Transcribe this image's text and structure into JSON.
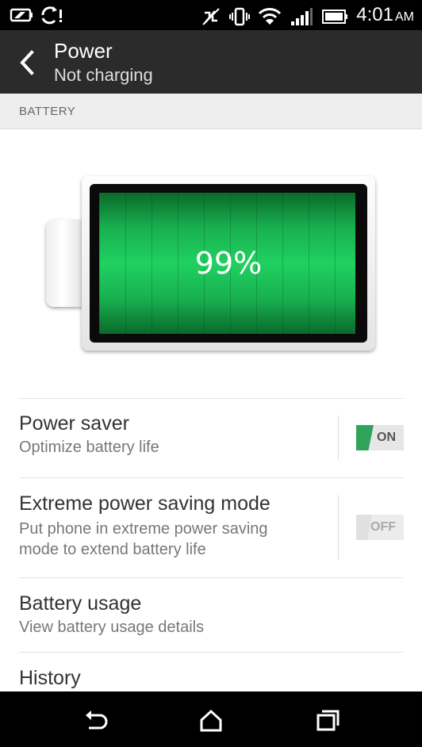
{
  "status_bar": {
    "time": "4:01",
    "ampm": "AM"
  },
  "header": {
    "title": "Power",
    "subtitle": "Not charging"
  },
  "section": {
    "label": "BATTERY"
  },
  "battery": {
    "percent_label": "99%",
    "level": 0.99,
    "color": "#1fd160"
  },
  "settings": [
    {
      "title": "Power saver",
      "summary": "Optimize battery life",
      "toggle_label": "ON",
      "toggle_state": true
    },
    {
      "title": "Extreme power saving mode",
      "summary_line1": "Put phone in extreme power saving",
      "summary_line2": "mode to extend battery life",
      "toggle_label": "OFF",
      "toggle_state": false
    },
    {
      "title": "Battery usage",
      "summary": "View battery usage details"
    },
    {
      "title": "History"
    }
  ],
  "colors": {
    "accent_green": "#2fa35a",
    "action_bar": "#2b2b2b"
  },
  "nav": {
    "icons": [
      "back-icon",
      "home-icon",
      "recents-icon"
    ]
  }
}
